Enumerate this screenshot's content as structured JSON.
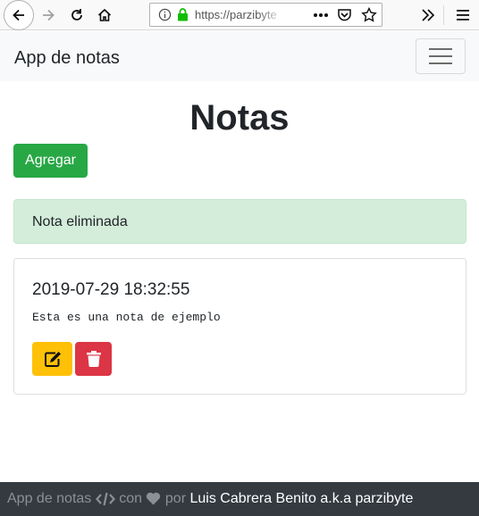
{
  "browser": {
    "url_display": "https://parzibyte",
    "icons": [
      "back-icon",
      "forward-icon",
      "reload-icon",
      "home-icon",
      "info-icon",
      "lock-icon",
      "more-icon",
      "pocket-icon",
      "bookmark-star-icon",
      "overflow-icon",
      "menu-icon"
    ]
  },
  "navbar": {
    "brand": "App de notas",
    "toggler_icon": "hamburger-icon"
  },
  "page": {
    "title": "Notas",
    "add_label": "Agregar"
  },
  "alert": {
    "message": "Nota eliminada",
    "color": "#d4edda"
  },
  "notes": [
    {
      "date": "2019-07-29 18:32:55",
      "body": "Esta es una nota de ejemplo",
      "edit_icon": "edit-icon",
      "delete_icon": "trash-icon"
    }
  ],
  "footer": {
    "app_name": "App de notas",
    "con": "con",
    "por": "por",
    "author": "Luis Cabrera Benito a.k.a parzibyte"
  },
  "colors": {
    "success": "#28a745",
    "warning": "#ffc107",
    "danger": "#dc3545",
    "footer_bg": "#343a40"
  }
}
